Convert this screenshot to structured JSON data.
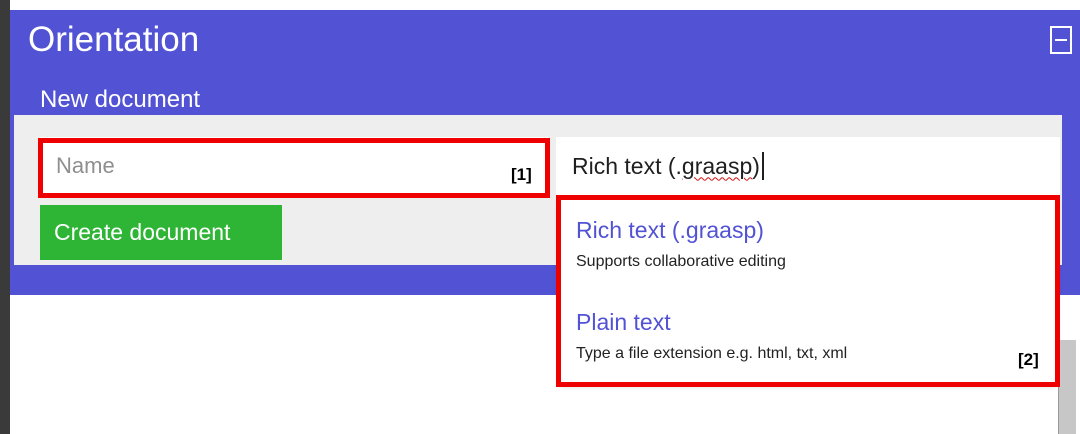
{
  "panel": {
    "title": "Orientation",
    "collapse_icon": "minus-square-icon",
    "section_title": "New document"
  },
  "form": {
    "name_placeholder": "Name",
    "name_value": "",
    "type_value_main": "Rich text (.",
    "type_value_misspelled": "graasp",
    "type_value_end": ")",
    "create_label": "Create document"
  },
  "dropdown": {
    "options": [
      {
        "title": "Rich text (.graasp)",
        "description": "Supports collaborative editing"
      },
      {
        "title": "Plain text",
        "description": "Type a file extension e.g. html, txt, xml"
      }
    ]
  },
  "annotations": {
    "label_1": "[1]",
    "label_2": "[2]"
  },
  "colors": {
    "header_bg": "#5152d4",
    "button_bg": "#2fb535",
    "annotation": "#ee0000",
    "option_title": "#5152d4"
  }
}
